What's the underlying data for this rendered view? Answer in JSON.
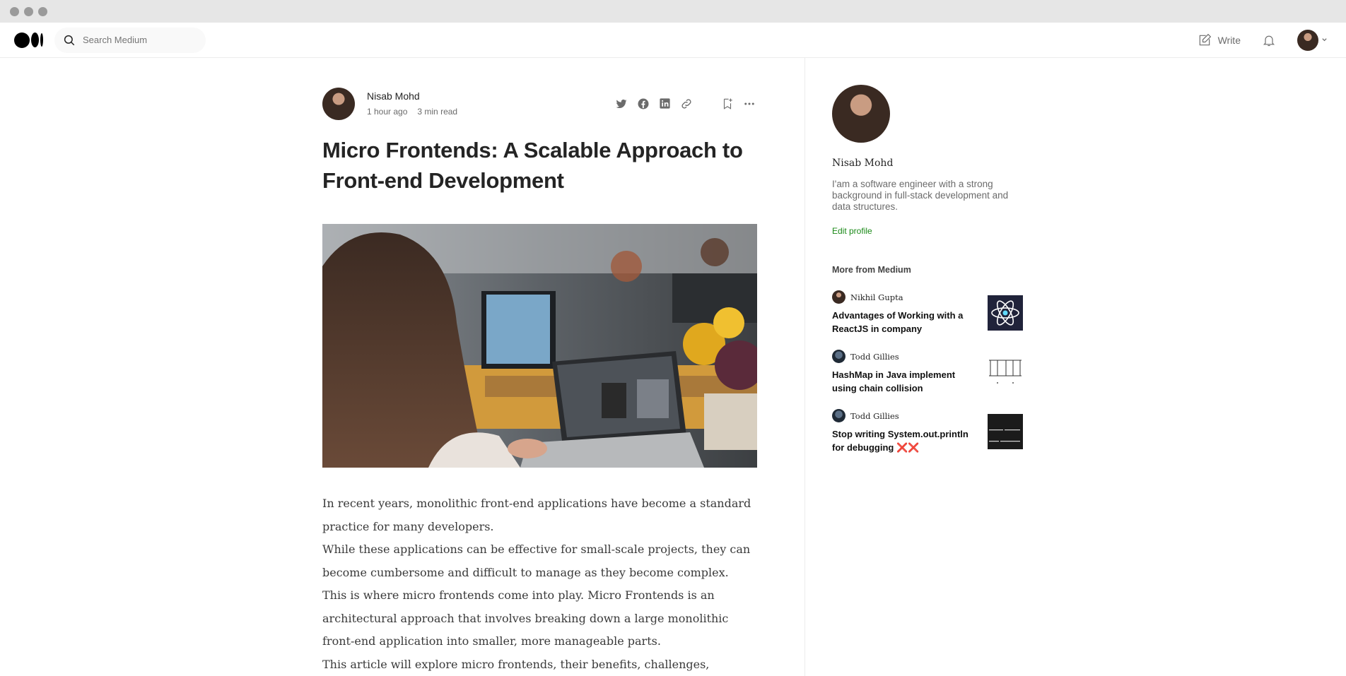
{
  "search": {
    "placeholder": "Search Medium"
  },
  "header": {
    "write_label": "Write"
  },
  "article": {
    "author": "Nisab Mohd",
    "time": "1 hour ago",
    "read_time": "3 min read",
    "title": "Micro Frontends: A Scalable Approach to Front-end Development",
    "paragraphs": [
      "In recent years, monolithic front-end applications have become a standard practice for many developers.",
      "While these applications can be effective for small-scale projects, they can become cumbersome and difficult to manage as they become complex.",
      "This is where micro frontends come into play. Micro Frontends is an architectural approach that involves breaking down a large monolithic front-end application into smaller, more manageable parts.",
      "This article will explore micro frontends, their benefits, challenges,"
    ]
  },
  "sidebar": {
    "name": "Nisab Mohd",
    "bio": "I'am a software engineer with a strong background in full-stack development and data structures.",
    "edit_label": "Edit profile",
    "more_heading": "More from Medium",
    "stories": [
      {
        "author": "Nikhil Gupta",
        "title": "Advantages of Working with a ReactJS in company"
      },
      {
        "author": "Todd Gillies",
        "title": "HashMap in Java implement using chain collision"
      },
      {
        "author": "Todd Gillies",
        "title": "Stop writing System.out.println for debugging ❌❌"
      }
    ]
  },
  "colors": {
    "accent_green": "#1a8917",
    "text": "#242424",
    "muted": "#6b6b6b"
  }
}
